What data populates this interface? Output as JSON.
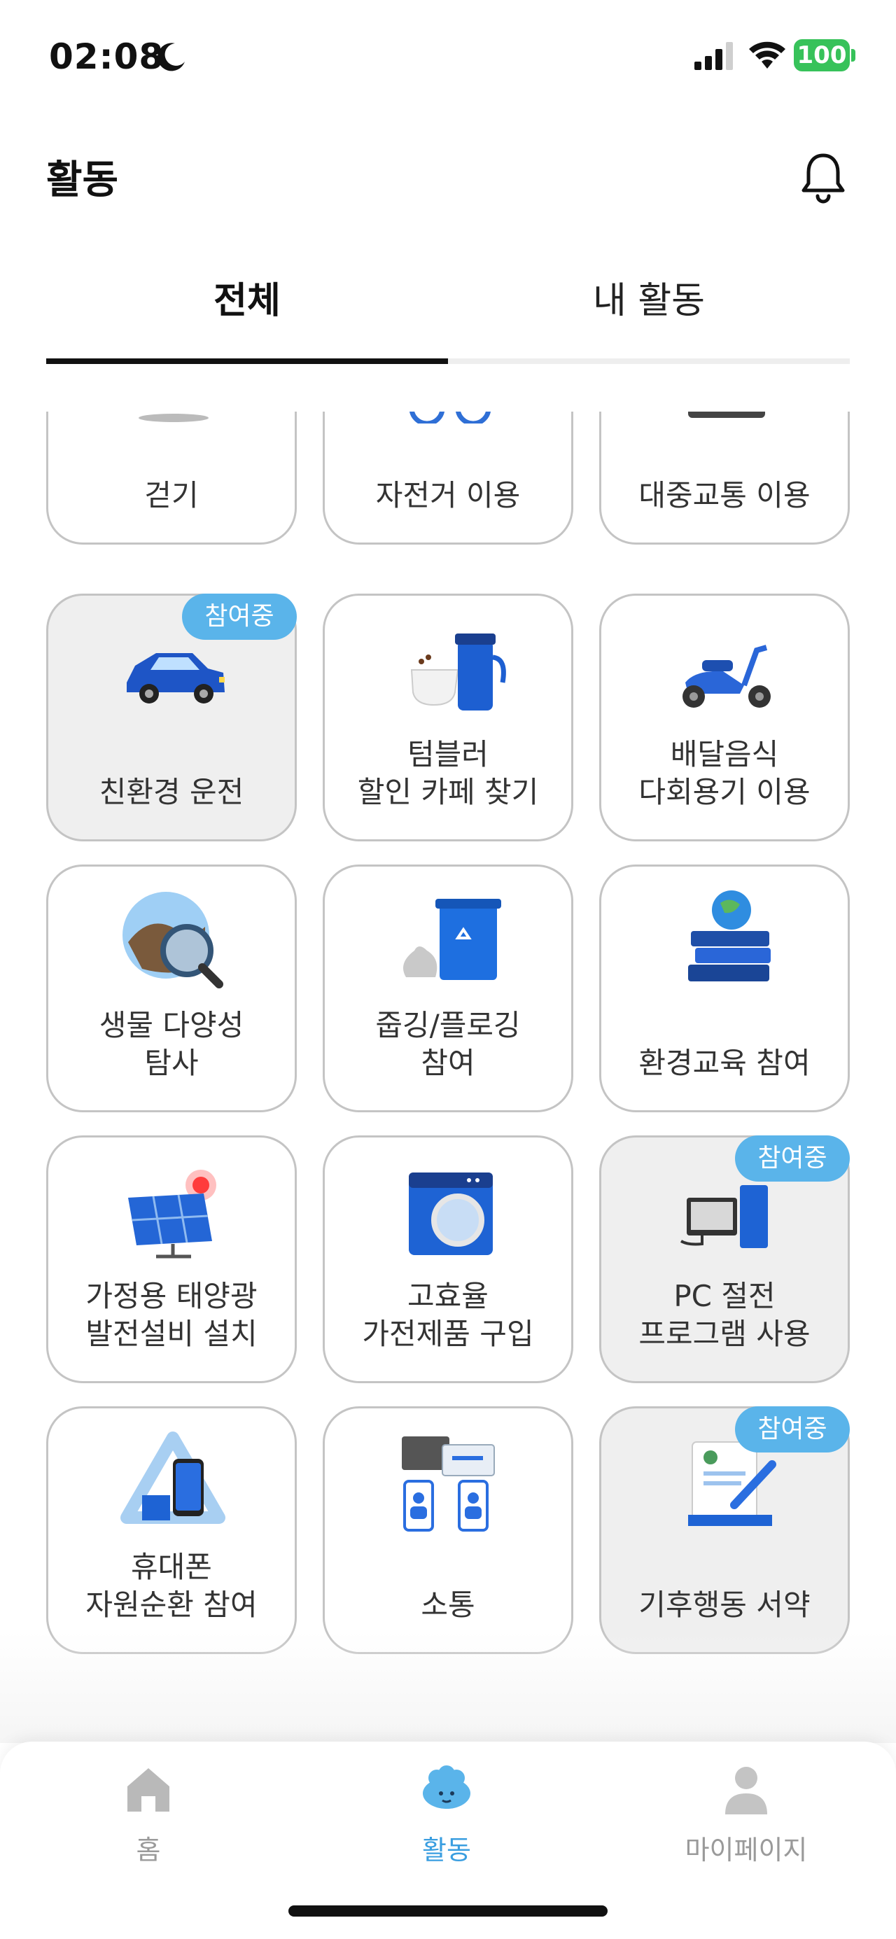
{
  "status_bar": {
    "time": "02:08",
    "battery": "100"
  },
  "header": {
    "title": "활동"
  },
  "tabs": [
    {
      "label": "전체",
      "active": true
    },
    {
      "label": "내 활동",
      "active": false
    }
  ],
  "badge_label": "참여중",
  "activities": [
    {
      "label": "걷기",
      "icon": "walking-icon",
      "joined": false
    },
    {
      "label": "자전거 이용",
      "icon": "bicycle-icon",
      "joined": false
    },
    {
      "label": "대중교통 이용",
      "icon": "public-transport-icon",
      "joined": false
    },
    {
      "label": "친환경 운전",
      "icon": "car-icon",
      "joined": true
    },
    {
      "label": "텀블러\n할인 카페 찾기",
      "icon": "tumbler-icon",
      "joined": false
    },
    {
      "label": "배달음식\n다회용기 이용",
      "icon": "scooter-icon",
      "joined": false
    },
    {
      "label": "생물 다양성\n탐사",
      "icon": "magnifier-globe-icon",
      "joined": false
    },
    {
      "label": "줍깅/플로깅\n참여",
      "icon": "recycle-bin-icon",
      "joined": false
    },
    {
      "label": "환경교육 참여",
      "icon": "books-globe-icon",
      "joined": false
    },
    {
      "label": "가정용 태양광\n발전설비 설치",
      "icon": "solar-panel-icon",
      "joined": false
    },
    {
      "label": "고효율\n가전제품 구입",
      "icon": "washing-machine-icon",
      "joined": false
    },
    {
      "label": "PC 절전\n프로그램 사용",
      "icon": "computer-icon",
      "joined": true
    },
    {
      "label": "휴대폰\n자원순환 참여",
      "icon": "phone-recycle-icon",
      "joined": false
    },
    {
      "label": "소통",
      "icon": "chat-people-icon",
      "joined": false
    },
    {
      "label": "기후행동 서약",
      "icon": "pledge-document-icon",
      "joined": true
    }
  ],
  "bottom_nav": [
    {
      "label": "홈",
      "icon": "home-icon",
      "active": false
    },
    {
      "label": "활동",
      "icon": "activity-character-icon",
      "active": true
    },
    {
      "label": "마이페이지",
      "icon": "profile-icon",
      "active": false
    }
  ],
  "colors": {
    "accent": "#5ab4ea",
    "active_nav": "#3a9ee0",
    "battery": "#37c25a"
  }
}
